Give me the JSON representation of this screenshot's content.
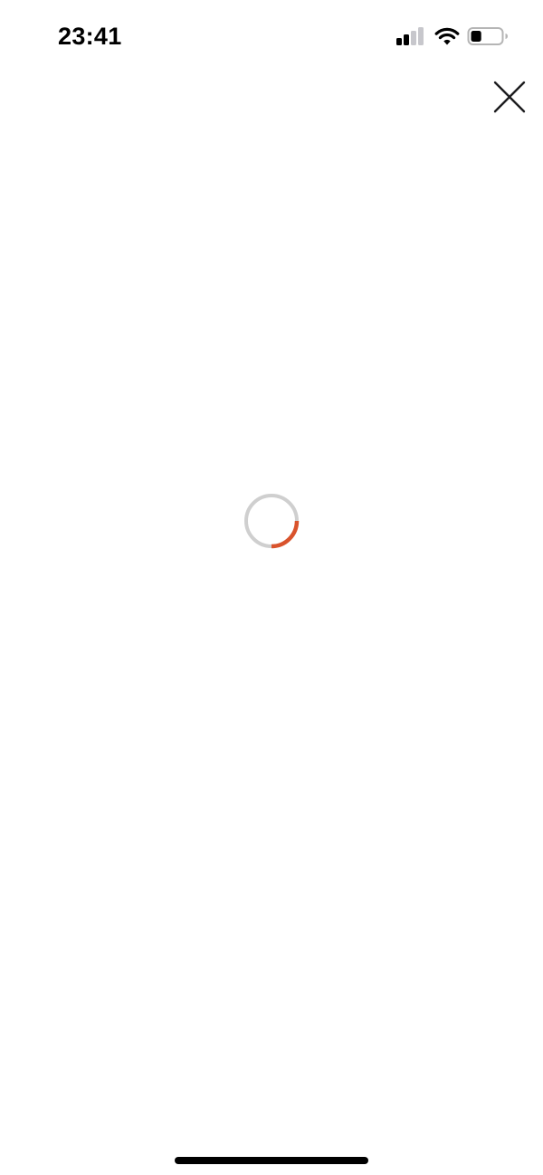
{
  "status_bar": {
    "time": "23:41",
    "icons": {
      "signal": "cellular-signal-icon",
      "wifi": "wifi-icon",
      "battery": "battery-icon"
    },
    "signal_bars_active": 2,
    "signal_bars_total": 4,
    "battery_level": 0.35
  },
  "toolbar": {
    "close_icon": "close-icon"
  },
  "loading": {
    "icon": "loading-spinner-icon",
    "track_color": "#cfcfcf",
    "accent_color": "#d9532c"
  },
  "home_indicator": {
    "color": "#000000"
  }
}
